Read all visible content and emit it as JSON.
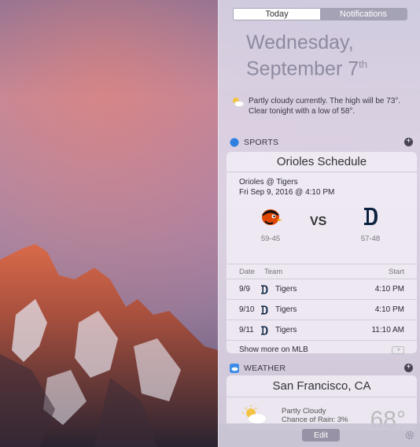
{
  "notification_center": {
    "tabs": [
      {
        "label": "Today",
        "selected": true
      },
      {
        "label": "Notifications",
        "selected": false
      }
    ],
    "date": {
      "weekday": "Wednesday,",
      "month_day": "September 7",
      "suffix": "th"
    },
    "weather_summary": {
      "icon": "partly-cloudy-icon",
      "line1": "Partly cloudy currently. The high will be 73°.",
      "line2": "Clear tonight with a low of 58°."
    },
    "sports": {
      "header": "SPORTS",
      "icon": "sports-compass-icon",
      "title": "Orioles Schedule",
      "matchup": "Orioles @ Tigers",
      "datetime": "Fri Sep 9, 2016 @ 4:10 PM",
      "home_record": "59-45",
      "away_record": "57-48",
      "vs": "VS",
      "columns": {
        "date": "Date",
        "team": "Team",
        "start": "Start"
      },
      "rows": [
        {
          "date": "9/9",
          "team": "Tigers",
          "start": "4:10 PM"
        },
        {
          "date": "9/10",
          "team": "Tigers",
          "start": "4:10 PM"
        },
        {
          "date": "9/11",
          "team": "Tigers",
          "start": "11:10 AM"
        }
      ],
      "more": "Show more on MLB"
    },
    "weather": {
      "header": "WEATHER",
      "icon": "weather-app-icon",
      "city": "San Francisco, CA",
      "condition": "Partly Cloudy",
      "condition2": "Chance of Rain: 3%",
      "temp": "68°"
    },
    "footer": {
      "edit": "Edit",
      "settings_icon": "gear-icon"
    },
    "colors": {
      "tiger_navy": "#0c2340",
      "orioles_orange": "#df4601"
    }
  }
}
